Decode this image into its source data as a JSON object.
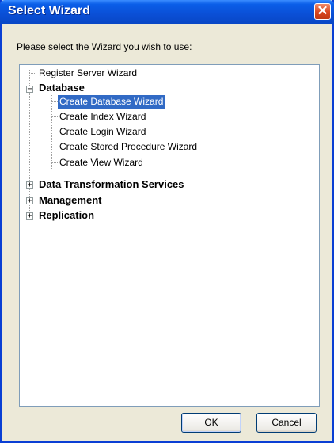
{
  "window": {
    "title": "Select Wizard",
    "close_glyph": "✕"
  },
  "prompt": "Please select the Wizard you wish to use:",
  "tree": {
    "items": [
      {
        "label": "Register Server Wizard"
      },
      {
        "label": "Database",
        "expander": "−"
      },
      {
        "label": "Create Database Wizard",
        "selected": true
      },
      {
        "label": "Create Index Wizard"
      },
      {
        "label": "Create Login Wizard"
      },
      {
        "label": "Create Stored Procedure Wizard"
      },
      {
        "label": "Create View Wizard"
      },
      {
        "label": "Data Transformation Services",
        "expander": "+"
      },
      {
        "label": "Management",
        "expander": "+"
      },
      {
        "label": "Replication",
        "expander": "+"
      }
    ]
  },
  "buttons": {
    "ok": "OK",
    "cancel": "Cancel"
  },
  "colors": {
    "titlebar": "#0a4fd6",
    "selection": "#316ac5"
  }
}
